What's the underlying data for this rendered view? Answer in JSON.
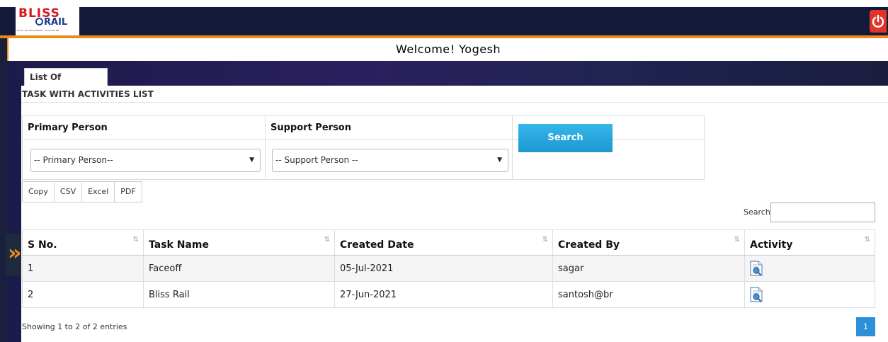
{
  "logo": {
    "brand_top": "BLISS",
    "brand_bottom": "RAIL",
    "tagline": "TASK MANAGEMENT SOFTWARE"
  },
  "header": {
    "welcome": "Welcome! Yogesh",
    "power_icon": "power-icon"
  },
  "tab": {
    "label": "List Of Activities",
    "close": "×"
  },
  "panel": {
    "title": "TASK WITH ACTIVITIES LIST"
  },
  "filters": {
    "primary_label": "Primary Person",
    "support_label": "Support Person",
    "primary_value": "-- Primary Person--",
    "support_value": "-- Support Person --",
    "search_button": "Search"
  },
  "exports": [
    "Copy",
    "CSV",
    "Excel",
    "PDF"
  ],
  "table_search": {
    "label": "Search:",
    "value": ""
  },
  "table": {
    "headers": [
      "S No.",
      "Task Name",
      "Created Date",
      "Created By",
      "Activity"
    ],
    "rows": [
      {
        "sno": "1",
        "task": "Faceoff",
        "date": "05-Jul-2021",
        "by": "sagar",
        "activity_icon": "document-view-icon"
      },
      {
        "sno": "2",
        "task": "Bliss Rail",
        "date": "27-Jun-2021",
        "by": "santosh@br",
        "activity_icon": "document-view-icon"
      }
    ]
  },
  "footer": {
    "showing": "Showing 1 to 2 of 2 entries",
    "page": "1"
  },
  "colors": {
    "topbar": "#141b3a",
    "accent": "#e98a1c",
    "button": "#1c98d2",
    "brand_red": "#d6191f"
  }
}
